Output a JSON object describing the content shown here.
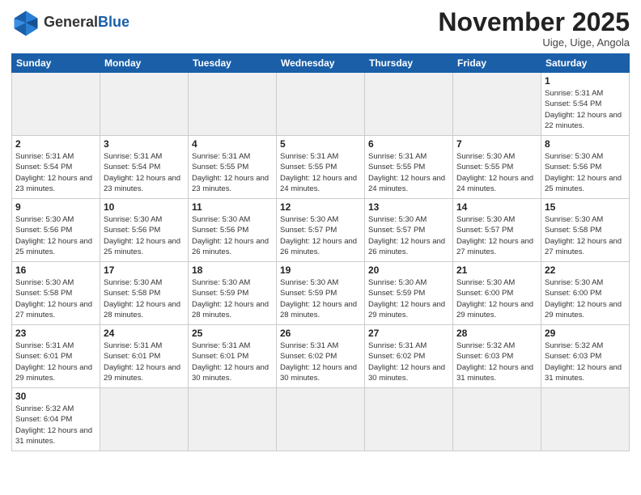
{
  "header": {
    "logo_general": "General",
    "logo_blue": "Blue",
    "month_title": "November 2025",
    "location": "Uige, Uige, Angola"
  },
  "weekdays": [
    "Sunday",
    "Monday",
    "Tuesday",
    "Wednesday",
    "Thursday",
    "Friday",
    "Saturday"
  ],
  "days": [
    {
      "num": "",
      "empty": true
    },
    {
      "num": "",
      "empty": true
    },
    {
      "num": "",
      "empty": true
    },
    {
      "num": "",
      "empty": true
    },
    {
      "num": "",
      "empty": true
    },
    {
      "num": "",
      "empty": true
    },
    {
      "num": "1",
      "sunrise": "5:31 AM",
      "sunset": "5:54 PM",
      "daylight": "12 hours and 22 minutes."
    },
    {
      "num": "2",
      "sunrise": "5:31 AM",
      "sunset": "5:54 PM",
      "daylight": "12 hours and 23 minutes."
    },
    {
      "num": "3",
      "sunrise": "5:31 AM",
      "sunset": "5:54 PM",
      "daylight": "12 hours and 23 minutes."
    },
    {
      "num": "4",
      "sunrise": "5:31 AM",
      "sunset": "5:55 PM",
      "daylight": "12 hours and 23 minutes."
    },
    {
      "num": "5",
      "sunrise": "5:31 AM",
      "sunset": "5:55 PM",
      "daylight": "12 hours and 24 minutes."
    },
    {
      "num": "6",
      "sunrise": "5:31 AM",
      "sunset": "5:55 PM",
      "daylight": "12 hours and 24 minutes."
    },
    {
      "num": "7",
      "sunrise": "5:30 AM",
      "sunset": "5:55 PM",
      "daylight": "12 hours and 24 minutes."
    },
    {
      "num": "8",
      "sunrise": "5:30 AM",
      "sunset": "5:56 PM",
      "daylight": "12 hours and 25 minutes."
    },
    {
      "num": "9",
      "sunrise": "5:30 AM",
      "sunset": "5:56 PM",
      "daylight": "12 hours and 25 minutes."
    },
    {
      "num": "10",
      "sunrise": "5:30 AM",
      "sunset": "5:56 PM",
      "daylight": "12 hours and 25 minutes."
    },
    {
      "num": "11",
      "sunrise": "5:30 AM",
      "sunset": "5:56 PM",
      "daylight": "12 hours and 26 minutes."
    },
    {
      "num": "12",
      "sunrise": "5:30 AM",
      "sunset": "5:57 PM",
      "daylight": "12 hours and 26 minutes."
    },
    {
      "num": "13",
      "sunrise": "5:30 AM",
      "sunset": "5:57 PM",
      "daylight": "12 hours and 26 minutes."
    },
    {
      "num": "14",
      "sunrise": "5:30 AM",
      "sunset": "5:57 PM",
      "daylight": "12 hours and 27 minutes."
    },
    {
      "num": "15",
      "sunrise": "5:30 AM",
      "sunset": "5:58 PM",
      "daylight": "12 hours and 27 minutes."
    },
    {
      "num": "16",
      "sunrise": "5:30 AM",
      "sunset": "5:58 PM",
      "daylight": "12 hours and 27 minutes."
    },
    {
      "num": "17",
      "sunrise": "5:30 AM",
      "sunset": "5:58 PM",
      "daylight": "12 hours and 28 minutes."
    },
    {
      "num": "18",
      "sunrise": "5:30 AM",
      "sunset": "5:59 PM",
      "daylight": "12 hours and 28 minutes."
    },
    {
      "num": "19",
      "sunrise": "5:30 AM",
      "sunset": "5:59 PM",
      "daylight": "12 hours and 28 minutes."
    },
    {
      "num": "20",
      "sunrise": "5:30 AM",
      "sunset": "5:59 PM",
      "daylight": "12 hours and 29 minutes."
    },
    {
      "num": "21",
      "sunrise": "5:30 AM",
      "sunset": "6:00 PM",
      "daylight": "12 hours and 29 minutes."
    },
    {
      "num": "22",
      "sunrise": "5:30 AM",
      "sunset": "6:00 PM",
      "daylight": "12 hours and 29 minutes."
    },
    {
      "num": "23",
      "sunrise": "5:31 AM",
      "sunset": "6:01 PM",
      "daylight": "12 hours and 29 minutes."
    },
    {
      "num": "24",
      "sunrise": "5:31 AM",
      "sunset": "6:01 PM",
      "daylight": "12 hours and 29 minutes."
    },
    {
      "num": "25",
      "sunrise": "5:31 AM",
      "sunset": "6:01 PM",
      "daylight": "12 hours and 30 minutes."
    },
    {
      "num": "26",
      "sunrise": "5:31 AM",
      "sunset": "6:02 PM",
      "daylight": "12 hours and 30 minutes."
    },
    {
      "num": "27",
      "sunrise": "5:31 AM",
      "sunset": "6:02 PM",
      "daylight": "12 hours and 30 minutes."
    },
    {
      "num": "28",
      "sunrise": "5:32 AM",
      "sunset": "6:03 PM",
      "daylight": "12 hours and 31 minutes."
    },
    {
      "num": "29",
      "sunrise": "5:32 AM",
      "sunset": "6:03 PM",
      "daylight": "12 hours and 31 minutes."
    },
    {
      "num": "30",
      "sunrise": "5:32 AM",
      "sunset": "6:04 PM",
      "daylight": "12 hours and 31 minutes."
    }
  ],
  "labels": {
    "sunrise": "Sunrise:",
    "sunset": "Sunset:",
    "daylight": "Daylight:"
  }
}
